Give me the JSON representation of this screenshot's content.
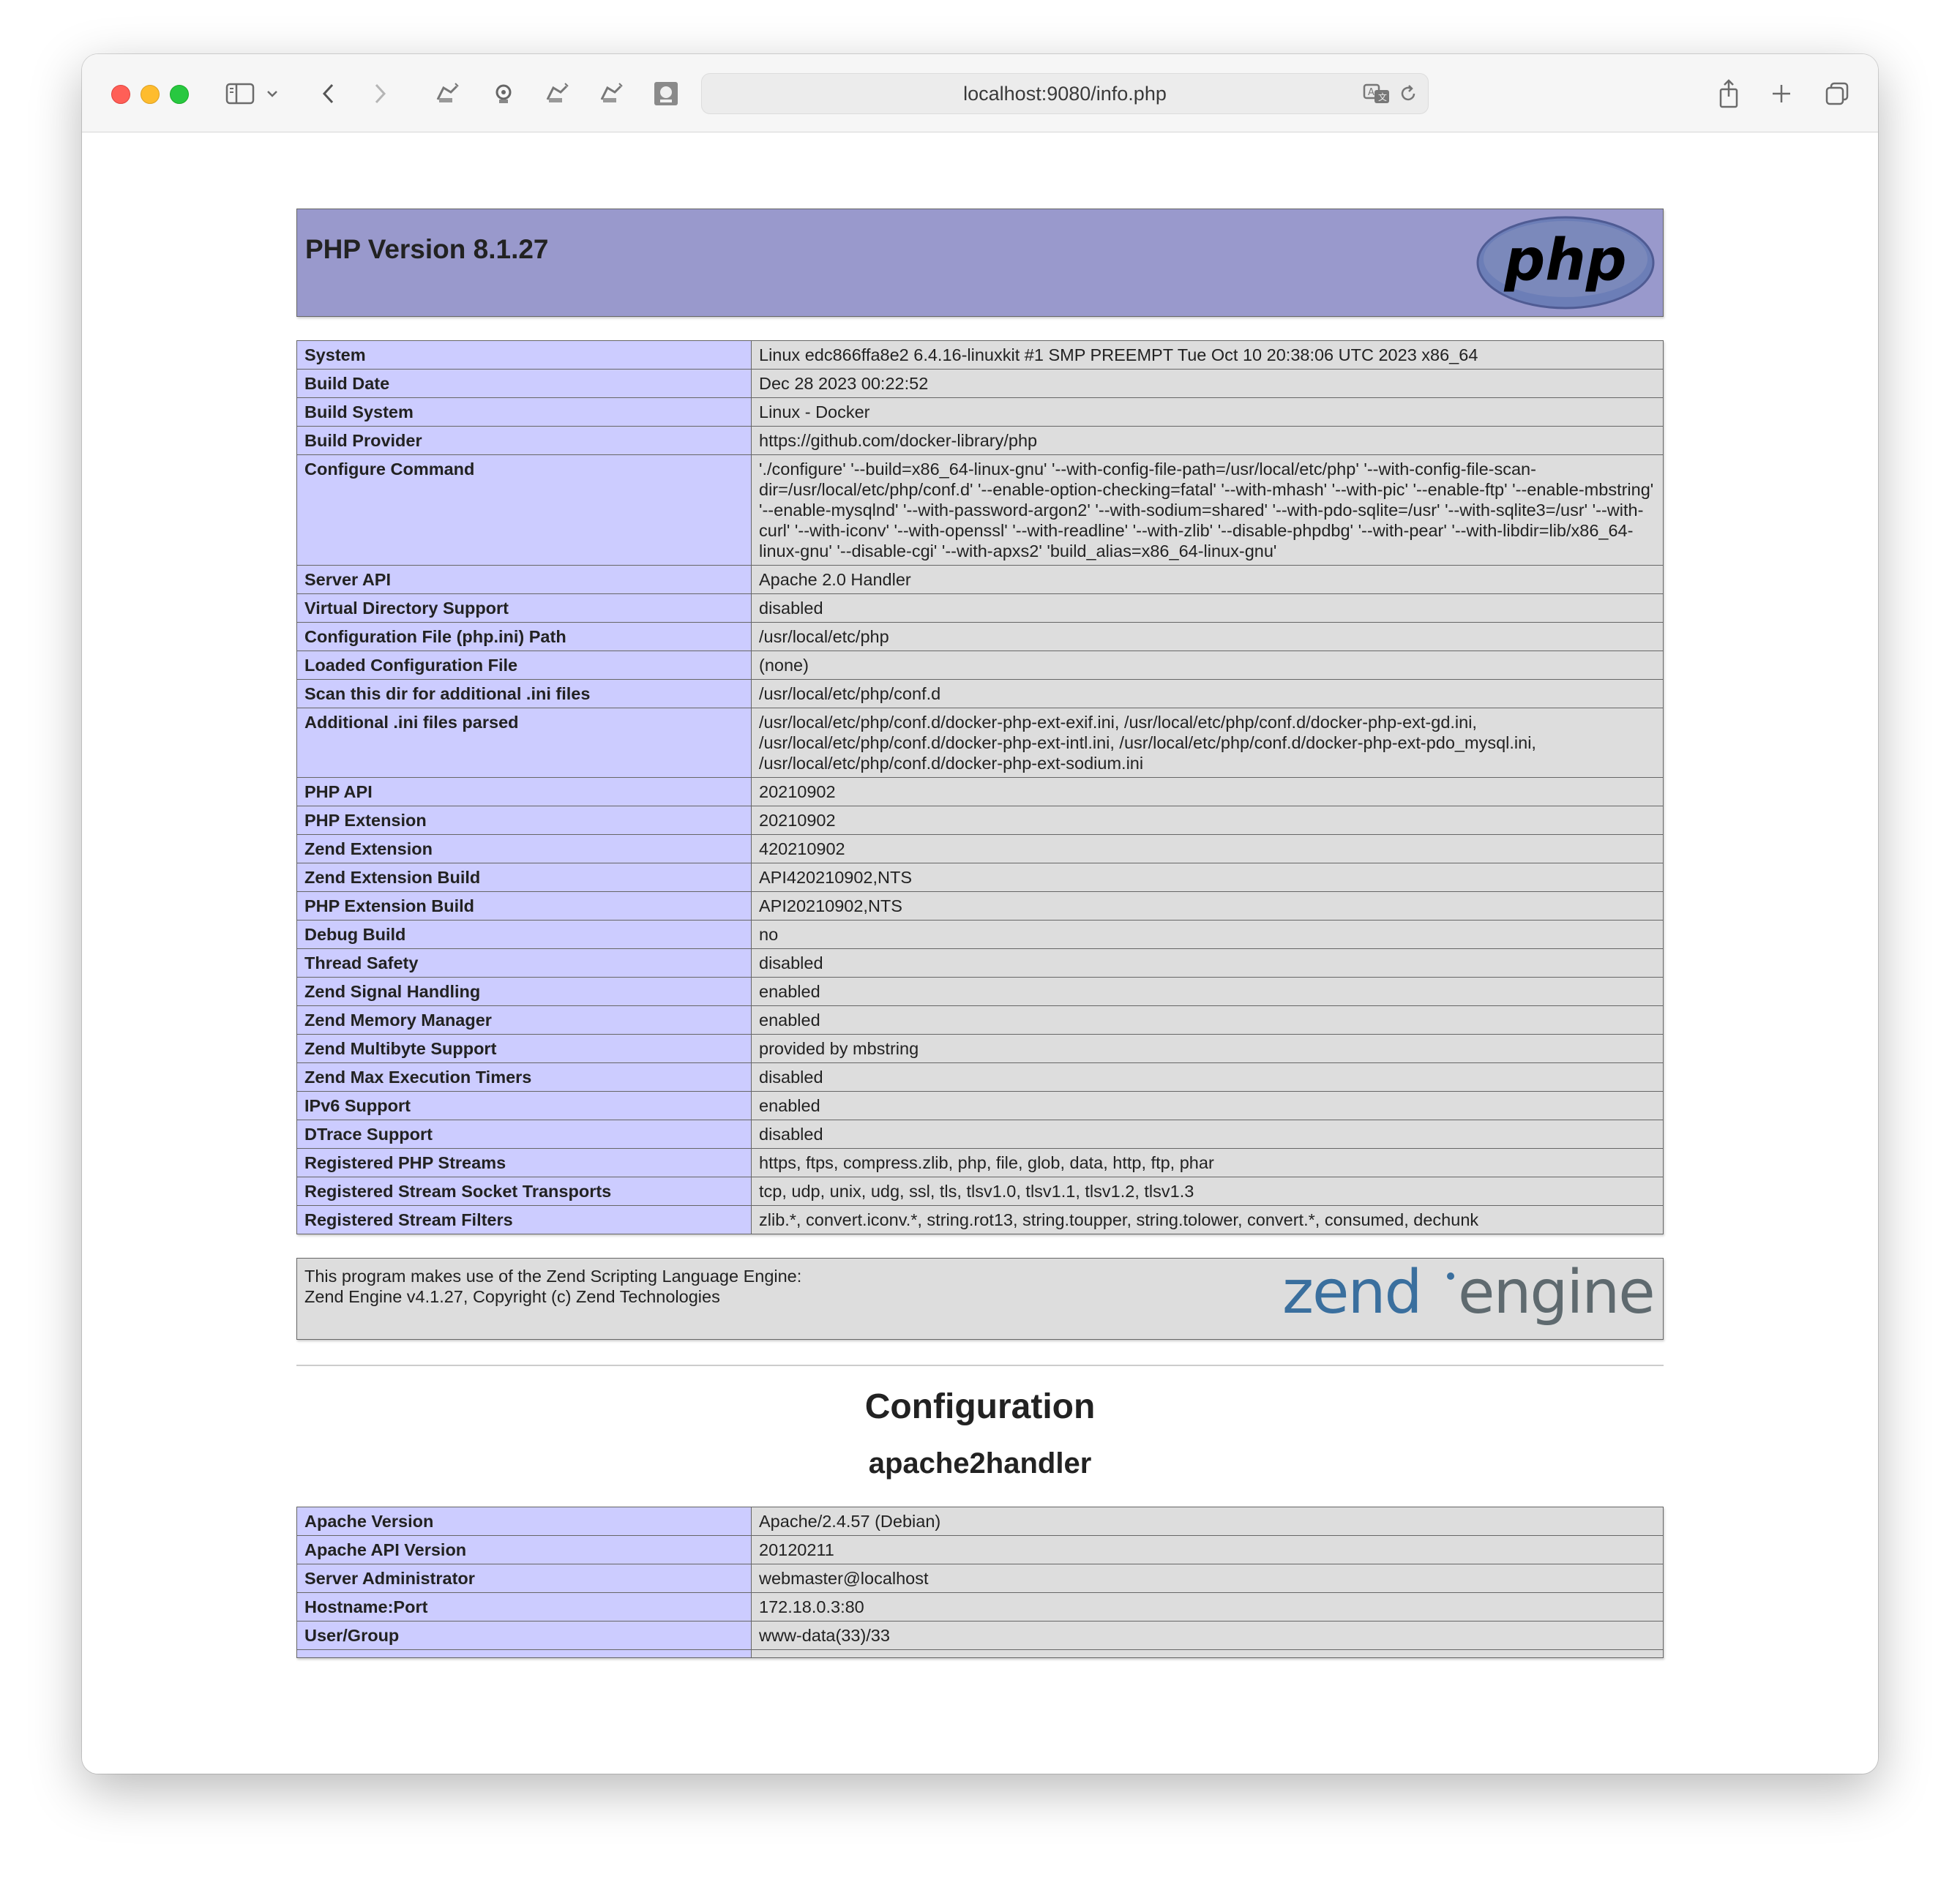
{
  "browser": {
    "url": "localhost:9080/info.php"
  },
  "header": {
    "title": "PHP Version 8.1.27",
    "logo_text": "php"
  },
  "info_rows": [
    {
      "label": "System",
      "value": "Linux edc866ffa8e2 6.4.16-linuxkit #1 SMP PREEMPT Tue Oct 10 20:38:06 UTC 2023 x86_64"
    },
    {
      "label": "Build Date",
      "value": "Dec 28 2023 00:22:52"
    },
    {
      "label": "Build System",
      "value": "Linux - Docker"
    },
    {
      "label": "Build Provider",
      "value": "https://github.com/docker-library/php"
    },
    {
      "label": "Configure Command",
      "value": "'./configure' '--build=x86_64-linux-gnu' '--with-config-file-path=/usr/local/etc/php' '--with-config-file-scan-dir=/usr/local/etc/php/conf.d' '--enable-option-checking=fatal' '--with-mhash' '--with-pic' '--enable-ftp' '--enable-mbstring' '--enable-mysqlnd' '--with-password-argon2' '--with-sodium=shared' '--with-pdo-sqlite=/usr' '--with-sqlite3=/usr' '--with-curl' '--with-iconv' '--with-openssl' '--with-readline' '--with-zlib' '--disable-phpdbg' '--with-pear' '--with-libdir=lib/x86_64-linux-gnu' '--disable-cgi' '--with-apxs2' 'build_alias=x86_64-linux-gnu'"
    },
    {
      "label": "Server API",
      "value": "Apache 2.0 Handler"
    },
    {
      "label": "Virtual Directory Support",
      "value": "disabled"
    },
    {
      "label": "Configuration File (php.ini) Path",
      "value": "/usr/local/etc/php"
    },
    {
      "label": "Loaded Configuration File",
      "value": "(none)"
    },
    {
      "label": "Scan this dir for additional .ini files",
      "value": "/usr/local/etc/php/conf.d"
    },
    {
      "label": "Additional .ini files parsed",
      "value": "/usr/local/etc/php/conf.d/docker-php-ext-exif.ini, /usr/local/etc/php/conf.d/docker-php-ext-gd.ini, /usr/local/etc/php/conf.d/docker-php-ext-intl.ini, /usr/local/etc/php/conf.d/docker-php-ext-pdo_mysql.ini, /usr/local/etc/php/conf.d/docker-php-ext-sodium.ini"
    },
    {
      "label": "PHP API",
      "value": "20210902"
    },
    {
      "label": "PHP Extension",
      "value": "20210902"
    },
    {
      "label": "Zend Extension",
      "value": "420210902"
    },
    {
      "label": "Zend Extension Build",
      "value": "API420210902,NTS"
    },
    {
      "label": "PHP Extension Build",
      "value": "API20210902,NTS"
    },
    {
      "label": "Debug Build",
      "value": "no"
    },
    {
      "label": "Thread Safety",
      "value": "disabled"
    },
    {
      "label": "Zend Signal Handling",
      "value": "enabled"
    },
    {
      "label": "Zend Memory Manager",
      "value": "enabled"
    },
    {
      "label": "Zend Multibyte Support",
      "value": "provided by mbstring"
    },
    {
      "label": "Zend Max Execution Timers",
      "value": "disabled"
    },
    {
      "label": "IPv6 Support",
      "value": "enabled"
    },
    {
      "label": "DTrace Support",
      "value": "disabled"
    },
    {
      "label": "Registered PHP Streams",
      "value": "https, ftps, compress.zlib, php, file, glob, data, http, ftp, phar"
    },
    {
      "label": "Registered Stream Socket Transports",
      "value": "tcp, udp, unix, udg, ssl, tls, tlsv1.0, tlsv1.1, tlsv1.2, tlsv1.3"
    },
    {
      "label": "Registered Stream Filters",
      "value": "zlib.*, convert.iconv.*, string.rot13, string.toupper, string.tolower, convert.*, consumed, dechunk"
    }
  ],
  "zend": {
    "line1": "This program makes use of the Zend Scripting Language Engine:",
    "line2": "Zend Engine v4.1.27, Copyright (c) Zend Technologies",
    "logo_zend": "zend",
    "logo_engine": "engine"
  },
  "configuration": {
    "heading": "Configuration",
    "subheading": "apache2handler",
    "rows": [
      {
        "label": "Apache Version",
        "value": "Apache/2.4.57 (Debian)"
      },
      {
        "label": "Apache API Version",
        "value": "20120211"
      },
      {
        "label": "Server Administrator",
        "value": "webmaster@localhost"
      },
      {
        "label": "Hostname:Port",
        "value": "172.18.0.3:80"
      },
      {
        "label": "User/Group",
        "value": "www-data(33)/33"
      },
      {
        "label": "",
        "value": ""
      }
    ]
  },
  "colors": {
    "header_bg": "#9999cc",
    "label_bg": "#ccccff",
    "value_bg": "#dddddd",
    "border": "#666666"
  }
}
